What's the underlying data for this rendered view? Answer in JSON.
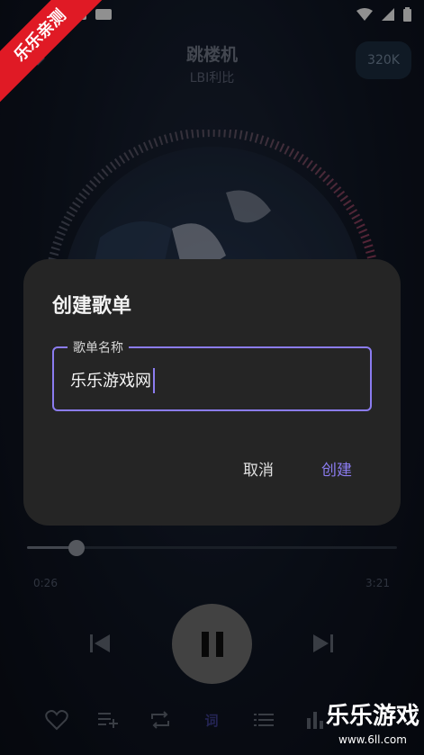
{
  "status_bar": {
    "time": ""
  },
  "header": {
    "title": "跳楼机",
    "artist": "LBI利比",
    "quality": "320K"
  },
  "player": {
    "current_time": "0:26",
    "total_time": "3:21",
    "progress": 0.135
  },
  "bottom_bar": {
    "lyric_label": "词"
  },
  "dialog": {
    "title": "创建歌单",
    "field_label": "歌单名称",
    "field_value": "乐乐游戏网",
    "cancel_label": "取消",
    "create_label": "创建"
  },
  "watermark": {
    "corner_text": "乐乐亲测",
    "brand_text": "乐乐游戏",
    "brand_url": "www.6ll.com"
  },
  "colors": {
    "accent": "#8b7cf0",
    "dialog_bg": "#252525",
    "watermark_red": "#e01a25"
  }
}
